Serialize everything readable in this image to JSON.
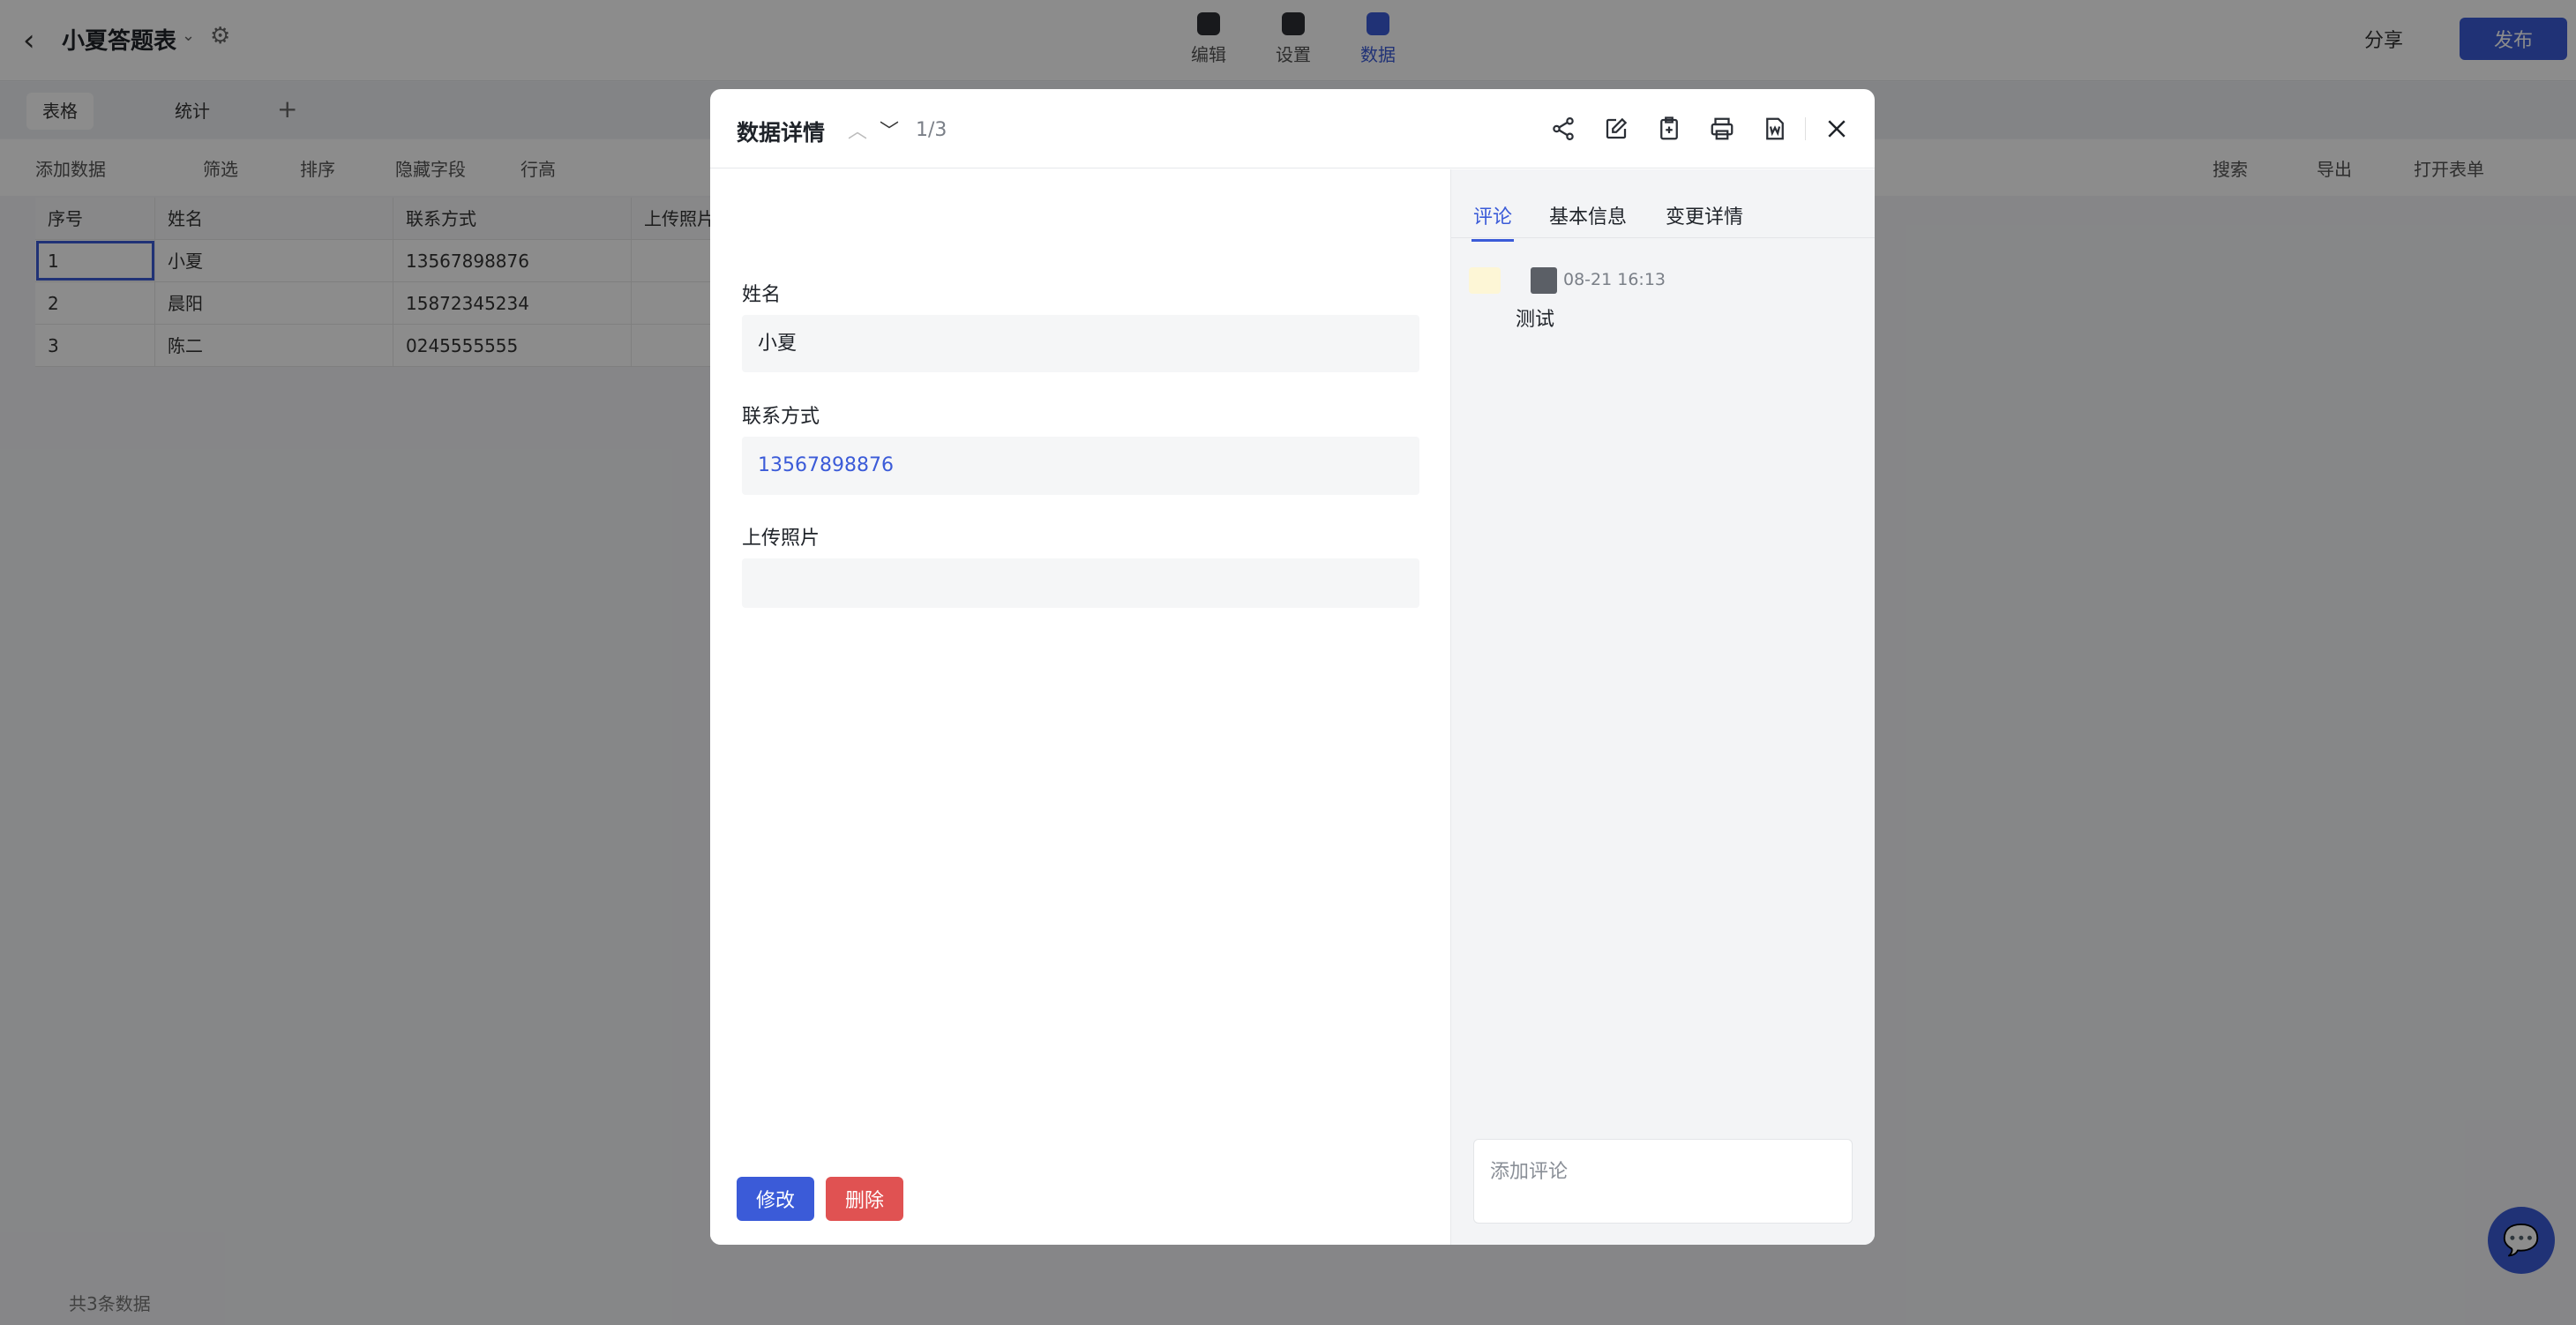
{
  "app": {
    "title": "小夏答题表",
    "top_tabs": [
      "编辑",
      "设置",
      "数据"
    ],
    "share_label": "分享",
    "publish_label": "发布"
  },
  "views": {
    "tabs": [
      "表格",
      "统计"
    ]
  },
  "toolbar": {
    "left": [
      "添加数据",
      "筛选",
      "排序",
      "隐藏字段",
      "行高"
    ],
    "right": [
      "搜索",
      "导出",
      "打开表单"
    ]
  },
  "grid": {
    "headers": [
      "序号",
      "姓名",
      "联系方式",
      "上传照片"
    ],
    "rows": [
      [
        "1",
        "小夏",
        "13567898876",
        ""
      ],
      [
        "2",
        "晨阳",
        "15872345234",
        ""
      ],
      [
        "3",
        "陈二",
        "0245555555",
        ""
      ]
    ],
    "footer": "共3条数据"
  },
  "modal": {
    "title": "数据详情",
    "counter": "1/3",
    "fields": [
      {
        "label": "姓名",
        "value": "小夏"
      },
      {
        "label": "联系方式",
        "value": "13567898876"
      },
      {
        "label": "上传照片",
        "value": ""
      }
    ],
    "edit_label": "修改",
    "delete_label": "删除",
    "tabs": [
      "评论",
      "基本信息",
      "变更详情"
    ],
    "comment": {
      "time": "08-21 16:13",
      "text": "测试"
    },
    "comment_placeholder": "添加评论"
  },
  "colors": {
    "accent": "#3b5bd8",
    "danger": "#e05252",
    "panel": "#f3f4f6"
  },
  "icons": [
    "share-icon",
    "edit-icon",
    "copy-icon",
    "print-icon",
    "word-export-icon",
    "close-icon"
  ]
}
